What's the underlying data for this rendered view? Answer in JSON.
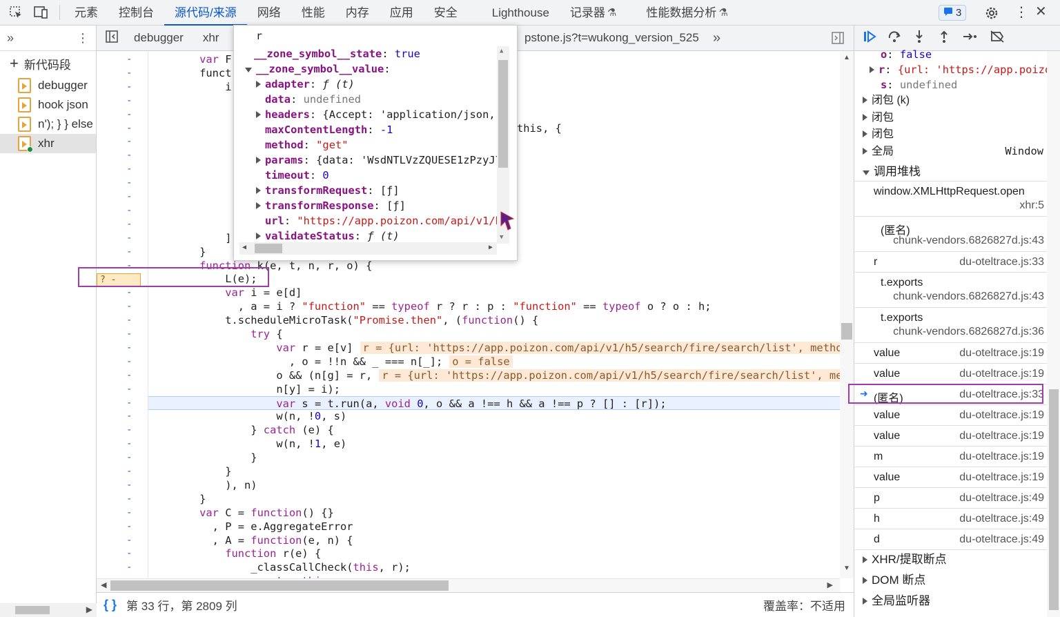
{
  "toolbar": {
    "tabs": [
      "元素",
      "控制台",
      "源代码/来源",
      "网络",
      "性能",
      "内存",
      "应用",
      "安全",
      "Lighthouse",
      "记录器",
      "性能数据分析"
    ],
    "active_tab": "源代码/来源",
    "issues_count": "3"
  },
  "navigator": {
    "new_snippet": "新代码段",
    "files": [
      "debugger",
      "hook json",
      "n'); } } else i",
      "xhr"
    ],
    "selected": "xhr"
  },
  "editor_tabs": [
    "debugger",
    "xhr",
    "pstone.js?t=wukong_version_525"
  ],
  "popup": {
    "title": "r",
    "rows": [
      {
        "key": "__zone_symbol__state",
        "value": "true",
        "type": "bool",
        "indent": 0,
        "expand": "none"
      },
      {
        "key": "__zone_symbol__value",
        "value": "",
        "type": "obj",
        "indent": 0,
        "expand": "down"
      },
      {
        "key": "adapter",
        "value": "ƒ (t)",
        "type": "fn",
        "indent": 1,
        "expand": "right"
      },
      {
        "key": "data",
        "value": "undefined",
        "type": "gray",
        "indent": 1,
        "expand": "none"
      },
      {
        "key": "headers",
        "value": "{Accept: 'application/json,",
        "type": "obj",
        "indent": 1,
        "expand": "right"
      },
      {
        "key": "maxContentLength",
        "value": "-1",
        "type": "num",
        "indent": 1,
        "expand": "none"
      },
      {
        "key": "method",
        "value": "\"get\"",
        "type": "str",
        "indent": 1,
        "expand": "none"
      },
      {
        "key": "params",
        "value": "{data: 'WsdNTLVzZQUESE1zPzyJ7",
        "type": "obj",
        "indent": 1,
        "expand": "right"
      },
      {
        "key": "timeout",
        "value": "0",
        "type": "num",
        "indent": 1,
        "expand": "none"
      },
      {
        "key": "transformRequest",
        "value": "[ƒ]",
        "type": "obj",
        "indent": 1,
        "expand": "right"
      },
      {
        "key": "transformResponse",
        "value": "[ƒ]",
        "type": "obj",
        "indent": 1,
        "expand": "right"
      },
      {
        "key": "url",
        "value": "\"https://app.poizon.com/api/v1/h",
        "type": "str",
        "indent": 1,
        "expand": "none"
      },
      {
        "key": "validateStatus",
        "value": "ƒ (t)",
        "type": "fn",
        "indent": 1,
        "expand": "right"
      }
    ]
  },
  "code": {
    "lines": [
      "        var F",
      "        funct",
      "            i",
      "",
      "",
      "",
      "",
      "",
      "",
      "",
      "",
      "",
      "",
      "            ]",
      "        }",
      "        function k(e, t, n, r, o) {",
      "            L(e);",
      "            var i = e[d]",
      "              , a = i ? \"function\" == typeof r ? r : p : \"function\" == typeof o ? o : h;",
      "            t.scheduleMicroTask(\"Promise.then\", (function() {",
      "                try {",
      "                    var r = e[v]",
      "                      , o = !!n && _ === n[_];",
      "                    o && (n[g] = r,",
      "                    n[y] = i);",
      "                    var s = t.run(a, void 0, o && a !== h && a !== p ? [] : [r]);",
      "                    w(n, !0, s)",
      "                } catch (e) {",
      "                    w(n, !1, e)",
      "                }",
      "            }",
      "            ), n)",
      "        }",
      "        var C = function() {}",
      "          , P = e.AggregateError",
      "          , A = function(e, n) {",
      "            function r(e) {",
      "                _classCallCheck(this, r);",
      "                var t = this;"
    ],
    "partial_right": "this, {",
    "inline_values": [
      {
        "line": 21,
        "text": "r = {url: 'https://app.poizon.com/api/v1/h5/search/fire/search/list', metho"
      },
      {
        "line": 22,
        "text": "o = false"
      },
      {
        "line": 23,
        "text": "r = {url: 'https://app.poizon.com/api/v1/h5/search/fire/search/list', me"
      }
    ],
    "breakpoint_label": "?  -"
  },
  "status": {
    "position": "第 33 行，第 2809 列",
    "coverage": "覆盖率：不适用"
  },
  "scope": {
    "rows": [
      {
        "key": "o",
        "value": "false",
        "type": "kw",
        "expand": "none"
      },
      {
        "key": "r",
        "value": "{url: 'https://app.poizo",
        "type": "str",
        "expand": "right"
      },
      {
        "key": "s",
        "value": "undefined",
        "type": "gray",
        "expand": "none"
      }
    ],
    "groups": [
      {
        "label": "闭包 (k)",
        "extra": ""
      },
      {
        "label": "闭包",
        "extra": ""
      },
      {
        "label": "闭包",
        "extra": ""
      },
      {
        "label": "全局",
        "extra": "Window"
      }
    ]
  },
  "callstack": {
    "title": "调用堆栈",
    "frames": [
      {
        "fn": "window.XMLHttpRequest.open",
        "loc": "xhr:5",
        "two_line": true
      },
      {
        "fn": "(匿名)",
        "loc": "chunk-vendors.6826827d.js:43",
        "two_line": true
      },
      {
        "fn": "r",
        "loc": "du-oteltrace.js:33",
        "two_line": false
      },
      {
        "fn": "t.exports",
        "loc": "chunk-vendors.6826827d.js:43",
        "two_line": true
      },
      {
        "fn": "t.exports",
        "loc": "chunk-vendors.6826827d.js:36",
        "two_line": true
      },
      {
        "fn": "value",
        "loc": "du-oteltrace.js:19",
        "two_line": false
      },
      {
        "fn": "value",
        "loc": "du-oteltrace.js:19",
        "two_line": false
      },
      {
        "fn": "(匿名)",
        "loc": "du-oteltrace.js:33",
        "two_line": false,
        "current": true
      },
      {
        "fn": "value",
        "loc": "du-oteltrace.js:19",
        "two_line": false
      },
      {
        "fn": "value",
        "loc": "du-oteltrace.js:19",
        "two_line": false
      },
      {
        "fn": "m",
        "loc": "du-oteltrace.js:19",
        "two_line": false
      },
      {
        "fn": "value",
        "loc": "du-oteltrace.js:19",
        "two_line": false
      },
      {
        "fn": "p",
        "loc": "du-oteltrace.js:49",
        "two_line": false
      },
      {
        "fn": "h",
        "loc": "du-oteltrace.js:49",
        "two_line": false
      },
      {
        "fn": "d",
        "loc": "du-oteltrace.js:49",
        "two_line": false
      }
    ]
  },
  "sections": [
    "XHR/提取断点",
    "DOM 断点",
    "全局监听器"
  ]
}
